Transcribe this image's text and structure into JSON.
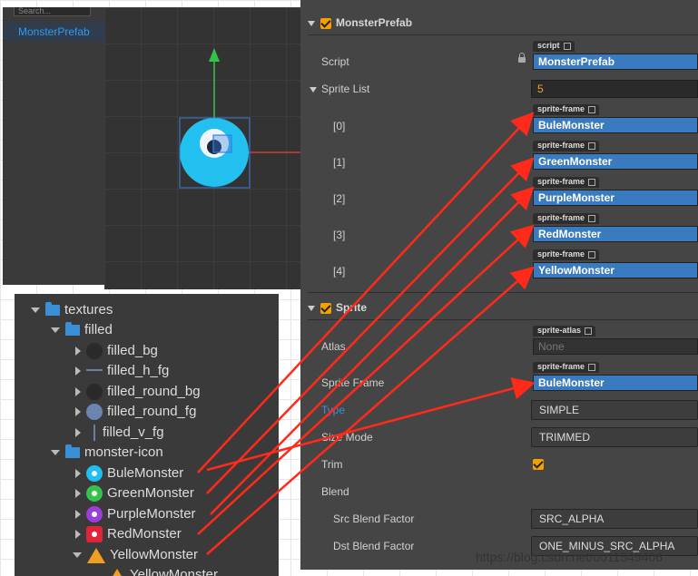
{
  "hierarchy": {
    "search_placeholder": "Search...",
    "selected_node": "MonsterPrefab"
  },
  "inspector": {
    "component1": {
      "title": "MonsterPrefab",
      "enabled": true
    },
    "script_label": "Script",
    "script_tag": "script",
    "script_value": "MonsterPrefab",
    "sprite_list_label": "Sprite List",
    "sprite_list_count": "5",
    "sprite_frame_tag": "sprite-frame",
    "sprite_list": [
      {
        "index": "[0]",
        "value": "BuleMonster"
      },
      {
        "index": "[1]",
        "value": "GreenMonster"
      },
      {
        "index": "[2]",
        "value": "PurpleMonster"
      },
      {
        "index": "[3]",
        "value": "RedMonster"
      },
      {
        "index": "[4]",
        "value": "YellowMonster"
      }
    ],
    "component2": {
      "title": "Sprite",
      "enabled": true
    },
    "atlas_label": "Atlas",
    "atlas_tag": "sprite-atlas",
    "atlas_value": "None",
    "sprite_frame_label": "Sprite Frame",
    "sprite_frame_value": "BuleMonster",
    "type_label": "Type",
    "type_value": "SIMPLE",
    "size_mode_label": "Size Mode",
    "size_mode_value": "TRIMMED",
    "trim_label": "Trim",
    "trim_checked": true,
    "blend_label": "Blend",
    "src_blend_label": "Src Blend Factor",
    "src_blend_value": "SRC_ALPHA",
    "dst_blend_label": "Dst Blend Factor",
    "dst_blend_value": "ONE_MINUS_SRC_ALPHA"
  },
  "assets": {
    "rows": [
      {
        "label": "textures",
        "kind": "folder-open"
      },
      {
        "label": "filled",
        "kind": "folder-open"
      },
      {
        "label": "filled_bg",
        "kind": "sprite"
      },
      {
        "label": "filled_h_fg",
        "kind": "sprite"
      },
      {
        "label": "filled_round_bg",
        "kind": "sprite"
      },
      {
        "label": "filled_round_fg",
        "kind": "sprite"
      },
      {
        "label": "filled_v_fg",
        "kind": "sprite"
      },
      {
        "label": "monster-icon",
        "kind": "folder-open"
      },
      {
        "label": "BuleMonster",
        "kind": "monster",
        "color": "#1ec0f0"
      },
      {
        "label": "GreenMonster",
        "kind": "monster",
        "color": "#36c24a"
      },
      {
        "label": "PurpleMonster",
        "kind": "monster",
        "color": "#9b3fd8"
      },
      {
        "label": "RedMonster",
        "kind": "monster",
        "color": "#e0243a"
      },
      {
        "label": "YellowMonster",
        "kind": "monster",
        "color": "#f0a020"
      },
      {
        "label": "YellowMonster",
        "kind": "sub"
      }
    ]
  },
  "watermark": "https://blog.csdn.net/u011549406",
  "colors": {
    "accent": "#3a7abf",
    "arrow": "#ff2a1a",
    "check": "#f4a100"
  }
}
